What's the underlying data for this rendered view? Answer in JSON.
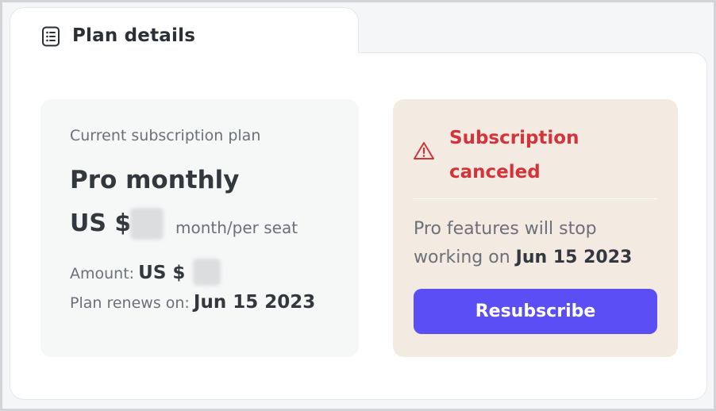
{
  "tab": {
    "title": "Plan details",
    "icon": "list-document-icon"
  },
  "current_plan": {
    "section_label": "Current subscription plan",
    "plan_name": "Pro monthly",
    "price_prefix": "US $",
    "price_unit": "month/per seat",
    "amount_label": "Amount:",
    "amount_prefix": "US $",
    "renew_label": "Plan renews on:",
    "renew_date": "Jun 15 2023"
  },
  "cancellation": {
    "icon": "warning-triangle-icon",
    "title": "Subscription canceled",
    "message_prefix": "Pro features will stop working on",
    "stop_date": "Jun 15 2023",
    "button_label": "Resubscribe"
  },
  "colors": {
    "accent": "#5b4ef5",
    "danger": "#d4333b",
    "card_left_bg": "#f6f7f7",
    "card_right_bg": "#f3ebe2"
  }
}
